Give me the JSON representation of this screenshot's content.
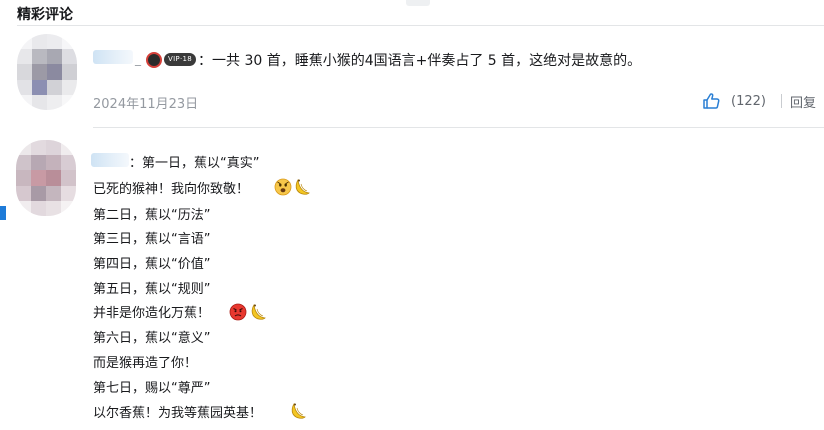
{
  "section": {
    "title": "精彩评论"
  },
  "comments": [
    {
      "username_suffix": "_",
      "vip_badge": "VIP·18",
      "text": "：一共 30 首，睡蕉小猴的4国语言+伴奏占了 5 首，这绝对是故意的。",
      "date": "2024年11月23日",
      "likes": "(122)",
      "reply_label": "回复"
    },
    {
      "lines": [
        "：第一日，蕉以“真实”",
        "已死的猴神！我向你致敬！",
        "第二日，蕉以“历法”",
        "第三日，蕉以“言语”",
        "第四日，蕉以“价值”",
        "第五日，蕉以“规则”",
        "并非是你造化万蕉！",
        "第六日，蕉以“意义”",
        "而是猴再造了你！",
        "第七日，赐以“尊严”",
        "以尔香蕉！为我等蕉园英基！"
      ]
    }
  ],
  "icons": {
    "like": "thumbs-up-icon",
    "emoji_1": "scared-face-emoji",
    "emoji_2": "angry-face-emoji",
    "emoji_banana": "banana-emoji"
  },
  "colors": {
    "accent": "#1e7bd8",
    "muted_text": "#9499a0",
    "body_text": "#18191c",
    "divider": "#e3e5e7"
  }
}
